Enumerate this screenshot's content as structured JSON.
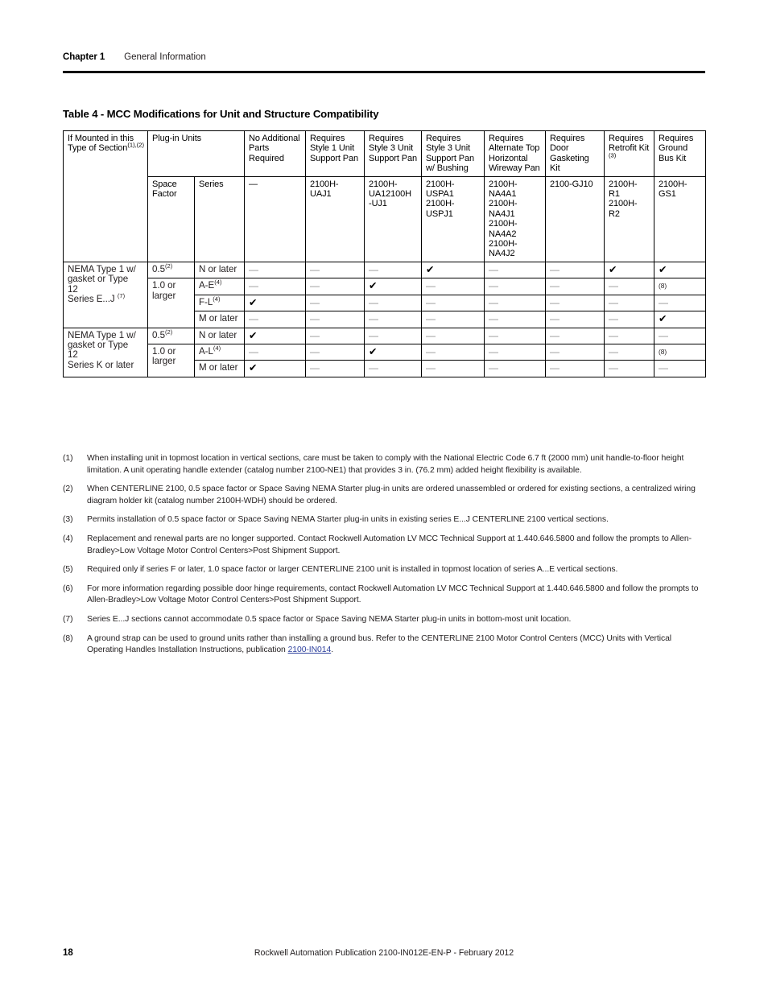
{
  "header": {
    "chapter": "Chapter 1",
    "chapter_title": "General Information"
  },
  "table_caption": "Table 4 - MCC Modifications for Unit and Structure Compatibility",
  "table": {
    "header_row1": {
      "col0_main": "If Mounted in this Type of Section",
      "col0_fn": "(1),(2)",
      "plug_in_units": "Plug-in Units",
      "columns": [
        "No Additional Parts Required",
        "Requires Style 1 Unit Support Pan",
        "Requires Style 3 Unit Support Pan",
        "Requires Style 3 Unit Support Pan w/ Bushing",
        "Requires Alternate Top Horizontal Wireway Pan",
        "Requires Door Gasketing Kit",
        "Requires Retrofit Kit",
        "Requires Ground Bus Kit"
      ],
      "retrofit_fn": "(3)"
    },
    "header_row2": {
      "space_factor": "Space Factor",
      "series": "Series",
      "part_numbers": [
        "—",
        "2100H-UAJ1",
        "2100H-UA12100H-UJ1",
        "2100H-USPA1 2100H-USPJ1",
        "2100H-NA4A1 2100H-NA4J1 2100H-NA4A2 2100H-NA4J2",
        "2100-GJ10",
        "2100H-R1 2100H-R2",
        "2100H-GS1"
      ],
      "part_numbers_lines": [
        [
          "—"
        ],
        [
          "2100H-",
          "UAJ1"
        ],
        [
          "2100H-",
          "UA12100H",
          "-UJ1"
        ],
        [
          "2100H-",
          "USPA1",
          "2100H-",
          "USPJ1"
        ],
        [
          "2100H-",
          "NA4A1",
          "2100H-",
          "NA4J1",
          "2100H-",
          "NA4A2",
          "2100H-",
          "NA4J2"
        ],
        [
          "2100-GJ10"
        ],
        [
          "2100H-",
          "R1",
          "2100H-",
          "R2"
        ],
        [
          "2100H-",
          "GS1"
        ]
      ]
    },
    "groups": [
      {
        "label_lines": [
          "NEMA Type 1 w/",
          "gasket or Type",
          "12",
          "Series E...J"
        ],
        "label_fn": "(7)",
        "rows": [
          {
            "space_factor": "0.5",
            "space_factor_fn": "(2)",
            "space_factor_rowspan": 1,
            "series": "N or later",
            "series_fn": "",
            "values": [
              "—",
              "—",
              "—",
              "check",
              "—",
              "—",
              "check",
              "check"
            ]
          },
          {
            "space_factor": "1.0 or larger",
            "space_factor_fn": "",
            "space_factor_rowspan": 3,
            "series": "A-E",
            "series_fn": "(4)",
            "values": [
              "—",
              "—",
              "check",
              "—",
              "—",
              "—",
              "—",
              "(8)"
            ]
          },
          {
            "space_factor": null,
            "space_factor_fn": "",
            "series": "F-L",
            "series_fn": "(4)",
            "values": [
              "check",
              "—",
              "—",
              "—",
              "—",
              "—",
              "—",
              "—"
            ]
          },
          {
            "space_factor": null,
            "space_factor_fn": "",
            "series": "M or later",
            "series_fn": "",
            "values": [
              "—",
              "—",
              "—",
              "—",
              "—",
              "—",
              "—",
              "check"
            ]
          }
        ]
      },
      {
        "label_lines": [
          "NEMA Type 1 w/",
          "gasket or Type",
          "12",
          "Series K or later"
        ],
        "label_fn": "",
        "rows": [
          {
            "space_factor": "0.5",
            "space_factor_fn": "(2)",
            "space_factor_rowspan": 1,
            "series": "N or later",
            "series_fn": "",
            "values": [
              "check",
              "—",
              "—",
              "—",
              "—",
              "—",
              "—",
              "—"
            ]
          },
          {
            "space_factor": "1.0 or larger",
            "space_factor_fn": "",
            "space_factor_rowspan": 2,
            "series": "A-L",
            "series_fn": "(4)",
            "values": [
              "—",
              "—",
              "check",
              "—",
              "—",
              "—",
              "—",
              "(8)"
            ]
          },
          {
            "space_factor": null,
            "space_factor_fn": "",
            "series": "M or later",
            "series_fn": "",
            "values": [
              "check",
              "—",
              "—",
              "—",
              "—",
              "—",
              "—",
              "—"
            ]
          }
        ]
      }
    ]
  },
  "footnotes": [
    {
      "num": "(1)",
      "text": "When installing unit in topmost location in vertical sections, care must be taken to comply with the National Electric Code 6.7 ft (2000 mm) unit handle-to-floor height limitation. A unit operating handle extender (catalog number 2100-NE1) that provides 3 in. (76.2 mm) added height flexibility is available."
    },
    {
      "num": "(2)",
      "text": "When CENTERLINE 2100, 0.5 space factor or Space Saving NEMA Starter plug-in units are ordered unassembled or ordered for existing sections, a centralized wiring diagram holder kit (catalog number 2100H-WDH) should be ordered."
    },
    {
      "num": "(3)",
      "text": "Permits installation of 0.5 space factor or Space Saving NEMA Starter plug-in units in existing series E...J CENTERLINE 2100 vertical sections."
    },
    {
      "num": "(4)",
      "text": "Replacement and renewal parts are no longer supported. Contact Rockwell Automation LV MCC Technical Support at 1.440.646.5800 and follow the prompts to Allen-Bradley>Low Voltage Motor Control Centers>Post Shipment Support."
    },
    {
      "num": "(5)",
      "text": "Required only if series F or later, 1.0 space factor or larger CENTERLINE 2100 unit is installed in topmost location of series A...E vertical sections."
    },
    {
      "num": "(6)",
      "text": "For more information regarding possible door hinge requirements, contact Rockwell Automation LV MCC Technical Support at 1.440.646.5800 and follow the prompts to Allen-Bradley>Low Voltage Motor Control Centers>Post Shipment Support."
    },
    {
      "num": "(7)",
      "text": "Series E...J sections cannot accommodate 0.5 space factor or Space Saving NEMA Starter plug-in units in bottom-most unit location."
    },
    {
      "num": "(8)",
      "text_before": "A ground strap can be used to ground units rather than installing a ground bus. Refer to the CENTERLINE 2100 Motor Control Centers (MCC) Units with Vertical Operating Handles Installation Instructions, publication ",
      "link": "2100-IN014",
      "text_after": "."
    }
  ],
  "footer": {
    "page_number": "18",
    "publication": "Rockwell Automation Publication 2100-IN012E-EN-P - February 2012"
  },
  "colors": {
    "text": "#231f20",
    "rule": "#000000",
    "link": "#2c3f9c",
    "dash": "#8d8d8d"
  }
}
